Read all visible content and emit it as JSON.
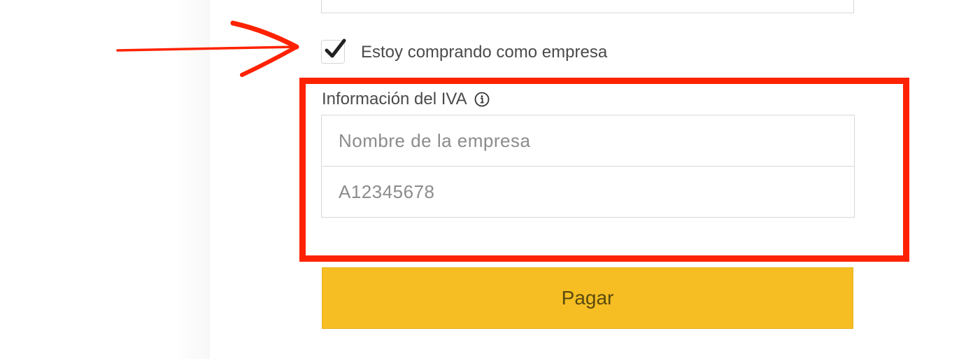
{
  "form": {
    "company_checkbox": {
      "checked": true,
      "label": "Estoy comprando como empresa"
    },
    "vat_section": {
      "title": "Información del IVA",
      "info_icon": "info-circle-icon",
      "company_name_placeholder": "Nombre de la empresa",
      "vat_id_placeholder": "A12345678"
    },
    "pay_button_label": "Pagar"
  },
  "annotations": {
    "arrow_icon": "hand-drawn-arrow-icon",
    "highlight_color": "#ff2200"
  },
  "colors": {
    "accent_button": "#f6be22",
    "text": "#4a4a4a",
    "placeholder": "#8c8c8c",
    "border": "#d8d8d8"
  }
}
